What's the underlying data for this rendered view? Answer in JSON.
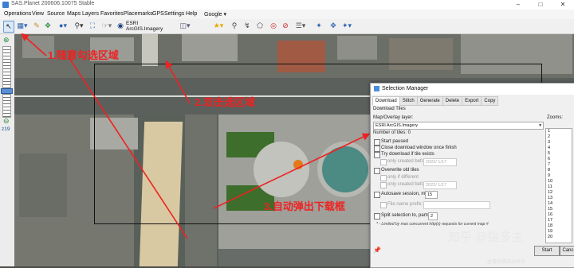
{
  "window": {
    "title": "SAS.Planet 200606.10075 Stable"
  },
  "menu": [
    "Operations",
    "View",
    "Source",
    "Maps",
    "Layers",
    "Favorites",
    "Placemarks",
    "GPS",
    "Settings",
    "Help",
    "Google ▾"
  ],
  "toolbar": {
    "map_source": "ESRI ArcGIS.Imagery"
  },
  "zoom": {
    "level": "z19"
  },
  "annotations": {
    "step1": "1.随意勾选区域",
    "step2": "2.双击选区域",
    "step3": "3.自动弹出下载框"
  },
  "dialog": {
    "title": "Selection Manager",
    "tabs": [
      "Download",
      "Stitch",
      "Generate",
      "Delete",
      "Export",
      "Copy"
    ],
    "section": "Download Tiles",
    "map_label": "Map/Overlay layer:",
    "map_value": "ESRI ArcGIS.Imagery",
    "tiles_label": "Number of tiles: 0",
    "zooms_label": "Zooms:",
    "zooms": [
      "1",
      "2",
      "3",
      "4",
      "5",
      "6",
      "7",
      "8",
      "9",
      "10",
      "11",
      "12",
      "13",
      "14",
      "15",
      "16",
      "17",
      "18",
      "19",
      "20"
    ],
    "start_paused": "Start paused",
    "close_window": "Close download window once finish",
    "try_download": "Try download if tile exists",
    "only_created_1": "only created before",
    "date_1": "2022/  1/17",
    "overwrite": "Overwrite old tiles",
    "only_if_diff": "only if different",
    "only_created_2": "only created before",
    "date_2": "2022/  1/17",
    "autosave": "Autosave session, min:",
    "autosave_val": "15",
    "file_prefix": "File name prefix:",
    "split": "Split selection to, parts*:",
    "split_val": "2",
    "footnote": "* - Limited by max concurrent http(s) requests for current map #",
    "start_button": "Start",
    "cancel_button": "Canc"
  },
  "watermark": {
    "main": "知乎 @锡多主",
    "sub": "@清业资讯公众号"
  },
  "colors": {
    "annotation": "#e22222",
    "accent": "#3c7fd0"
  }
}
